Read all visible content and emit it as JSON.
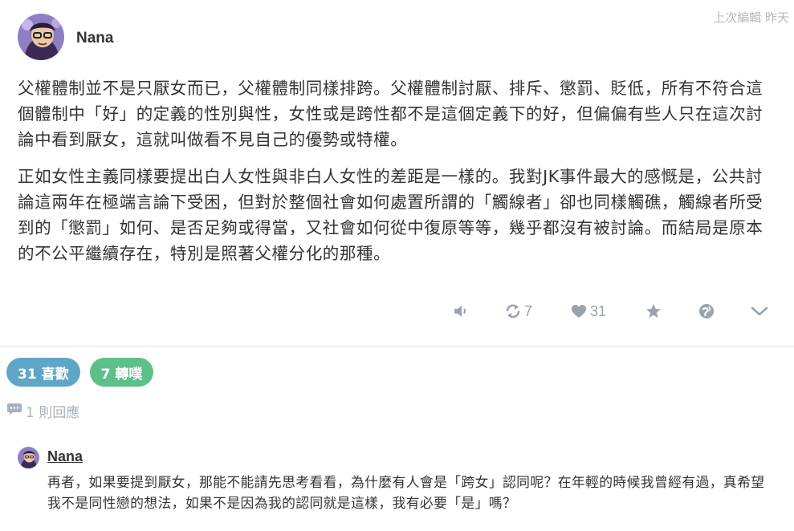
{
  "post": {
    "author": "Nana",
    "edited": "上次編輯 昨天",
    "paragraphs": [
      "父權體制並不是只厭女而已，父權體制同樣排跨。父權體制討厭、排斥、懲罰、貶低，所有不符合這個體制中「好」的定義的性別與性，女性或是跨性都不是這個定義下的好，但偏偏有些人只在這次討論中看到厭女，這就叫做看不見自己的優勢或特權。",
      "正如女性主義同樣要提出白人女性與非白人女性的差距是一樣的。我對JK事件最大的感慨是，公共討論這兩年在極端言論下受困，但對於整個社會如何處置所謂的「觸線者」卻也同樣觸礁，觸線者所受到的「懲罰」如何、是否足夠或得當，又社會如何從中復原等等，幾乎都沒有被討論。而結局是原本的不公平繼續存在，特別是照著父權分化的那種。"
    ],
    "actions": {
      "repost_count": "7",
      "like_count": "31"
    }
  },
  "stats": {
    "likes_label": "31 喜歡",
    "reposts_label": "7 轉噗"
  },
  "replies": {
    "count_label": "1 則回應"
  },
  "comment": {
    "author": "Nana",
    "text": "再者，如果要提到厭女，那能不能請先思考看看，為什麼有人會是「跨女」認同呢？在年輕的時候我曾經有過，真希望我不是同性戀的想法，如果不是因為我的認同就是這樣，我有必要「是」嗎？"
  },
  "colors": {
    "likes_pill": "#5fa6c6",
    "reposts_pill": "#5cc089",
    "icon_gray": "#9aa3ad"
  }
}
